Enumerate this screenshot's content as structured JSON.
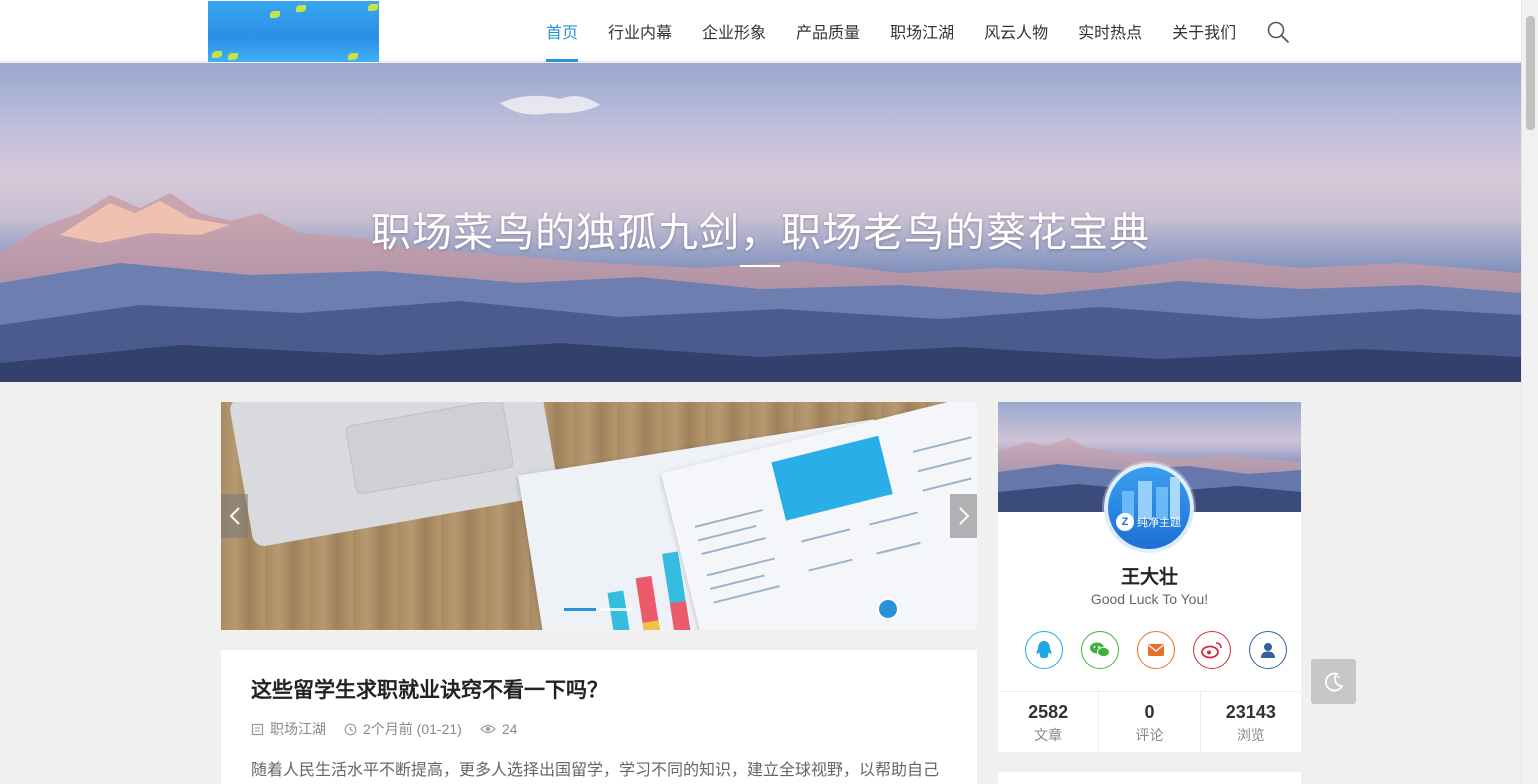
{
  "nav": {
    "items": [
      {
        "label": "首页"
      },
      {
        "label": "行业内幕"
      },
      {
        "label": "企业形象"
      },
      {
        "label": "产品质量"
      },
      {
        "label": "职场江湖"
      },
      {
        "label": "风云人物"
      },
      {
        "label": "实时热点"
      },
      {
        "label": "关于我们"
      }
    ],
    "active_index": 0,
    "accent": "#2a93d8"
  },
  "hero": {
    "title": "职场菜鸟的独孤九剑，职场老鸟的葵花宝典"
  },
  "post": {
    "title": "这些留学生求职就业诀窍不看一下吗？",
    "category": "职场江湖",
    "date": "2个月前 (01-21)",
    "views": "24",
    "excerpt": "随着人民生活水平不断提高，更多人选择出国留学，学习不同的知识，建立全球视野，以帮助自己"
  },
  "profile": {
    "avatar_label": "纯净主题",
    "avatar_mark": "Z",
    "name": "王大壮",
    "motto": "Good Luck To You!",
    "socials": [
      {
        "icon": "qq-icon",
        "color": "#1ca8e3"
      },
      {
        "icon": "wechat-icon",
        "color": "#3db13d"
      },
      {
        "icon": "mail-icon",
        "color": "#e7702b"
      },
      {
        "icon": "weibo-icon",
        "color": "#d8293a"
      },
      {
        "icon": "user-icon",
        "color": "#34609d"
      }
    ],
    "stats": [
      {
        "value": "2582",
        "label": "文章"
      },
      {
        "value": "0",
        "label": "评论"
      },
      {
        "value": "23143",
        "label": "浏览"
      }
    ]
  },
  "slider": {
    "active_dot": 0,
    "dot_count": 2
  }
}
